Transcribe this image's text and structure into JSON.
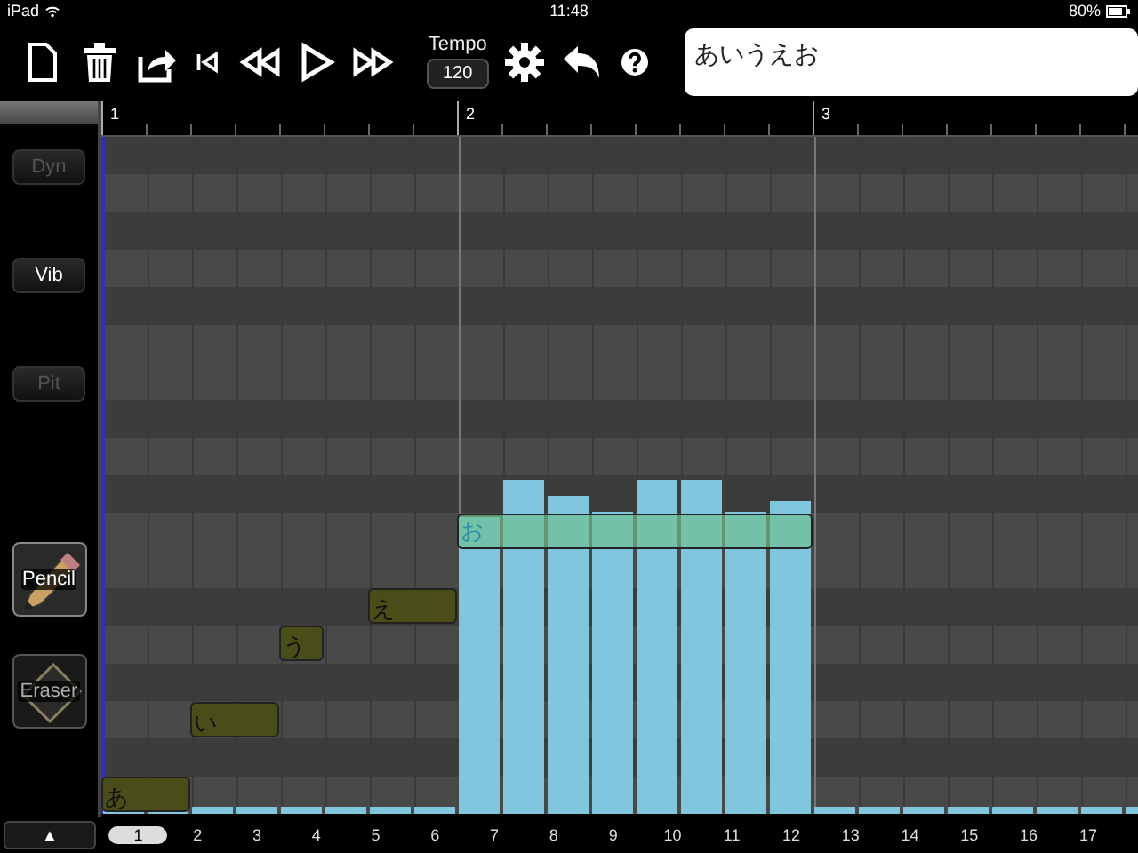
{
  "status_bar": {
    "device": "iPad",
    "time": "11:48",
    "battery": "80%"
  },
  "toolbar": {
    "tempo_label": "Tempo",
    "tempo_value": "120",
    "lyrics": "あいうえお"
  },
  "side_buttons": [
    {
      "label": "Dyn",
      "disabled": true
    },
    {
      "label": "Vib",
      "disabled": false
    },
    {
      "label": "Pit",
      "disabled": true
    }
  ],
  "tools": [
    {
      "label": "Pencil",
      "kind": "pencil",
      "selected": true
    },
    {
      "label": "Eraser",
      "kind": "eraser",
      "selected": false
    }
  ],
  "expand_button": "▲",
  "ruler": [
    "1",
    "2",
    "3"
  ],
  "notes": [
    {
      "lyric": "あ",
      "selected": false
    },
    {
      "lyric": "い",
      "selected": false
    },
    {
      "lyric": "う",
      "selected": false
    },
    {
      "lyric": "え",
      "selected": false
    },
    {
      "lyric": "お",
      "selected": true
    }
  ],
  "pages": [
    {
      "label": "1",
      "selected": true
    },
    {
      "label": "2",
      "selected": false
    },
    {
      "label": "3",
      "selected": false
    },
    {
      "label": "4",
      "selected": false
    },
    {
      "label": "5",
      "selected": false
    },
    {
      "label": "6",
      "selected": false
    },
    {
      "label": "7",
      "selected": false
    },
    {
      "label": "8",
      "selected": false
    },
    {
      "label": "9",
      "selected": false
    },
    {
      "label": "10",
      "selected": false
    },
    {
      "label": "11",
      "selected": false
    },
    {
      "label": "12",
      "selected": false
    },
    {
      "label": "13",
      "selected": false
    },
    {
      "label": "14",
      "selected": false
    },
    {
      "label": "15",
      "selected": false
    },
    {
      "label": "16",
      "selected": false
    },
    {
      "label": "17",
      "selected": false
    }
  ]
}
